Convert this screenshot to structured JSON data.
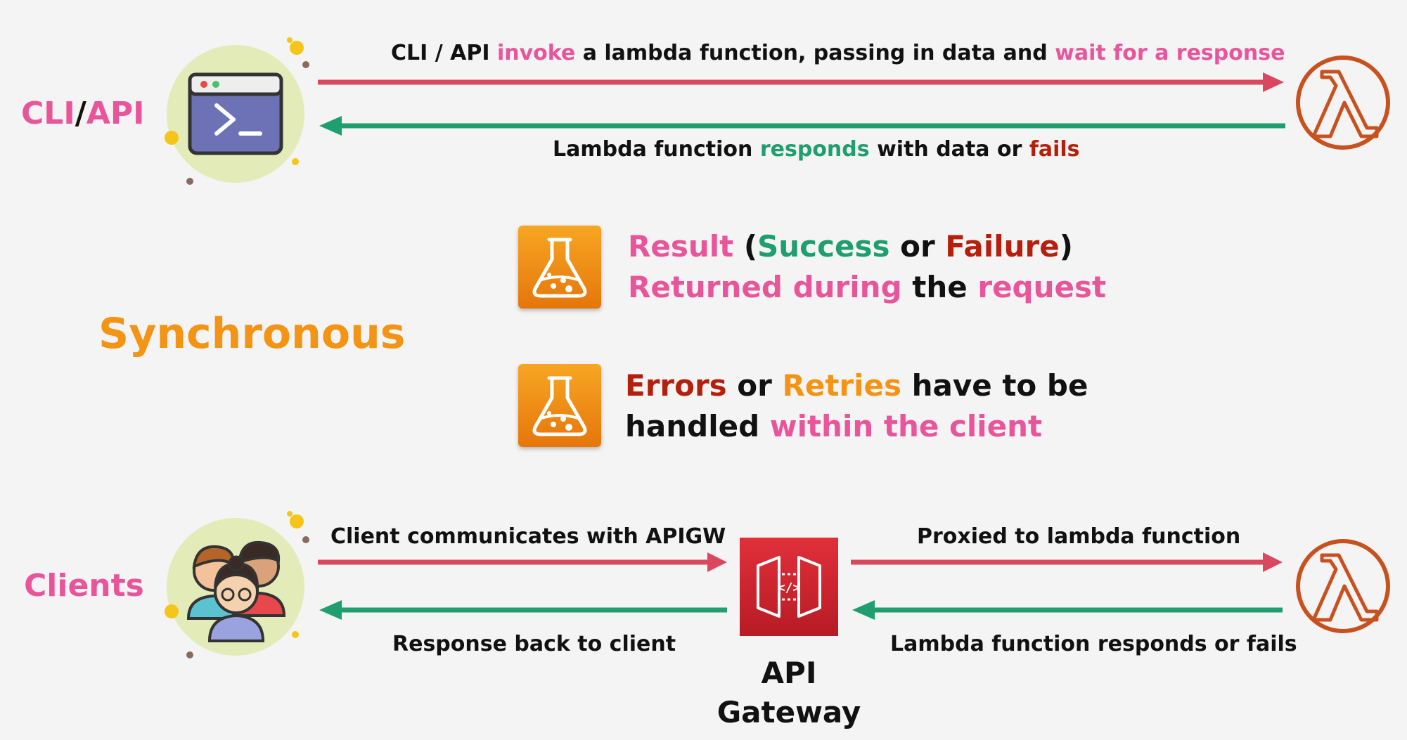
{
  "labels": {
    "cli_part1": "CLI",
    "cli_sep": "/",
    "cli_part2": "API",
    "clients": "Clients",
    "synchronous": "Synchronous"
  },
  "top_flow": {
    "invoke_caption": {
      "t1": "CLI / API ",
      "t2": "invoke",
      "t3": " a lambda function, passing in data and ",
      "t4": "wait for a response"
    },
    "responds_caption": {
      "t1": "Lambda function ",
      "t2": "responds",
      "t3": " with data or ",
      "t4": "fails"
    }
  },
  "info_result": {
    "line1": {
      "t1": "Result",
      "t2": " (",
      "t3": "Success",
      "t4": " or ",
      "t5": "Failure",
      "t6": ")"
    },
    "line2": {
      "t1": "Returned during",
      "t2": " the ",
      "t3": "request"
    }
  },
  "info_errors": {
    "line1": {
      "t1": "Errors",
      "t2": " or ",
      "t3": "Retries",
      "t4": " have to be"
    },
    "line2": {
      "t1": "handled ",
      "t2": "within the client"
    }
  },
  "bottom_flow": {
    "client_caption": "Client communicates with APIGW",
    "proxied_caption": "Proxied to lambda function",
    "back_caption": "Response back to client",
    "lambda_fails_caption": "Lambda function responds or fails",
    "apigw_line1": "API",
    "apigw_line2": "Gateway"
  },
  "colors": {
    "pink": "#e8559a",
    "green": "#1f9e6f",
    "red": "#b5200d",
    "orange": "#f39414",
    "arrow_red": "#d9485f",
    "arrow_green": "#1f9e6f",
    "lambda": "#c7511f"
  }
}
